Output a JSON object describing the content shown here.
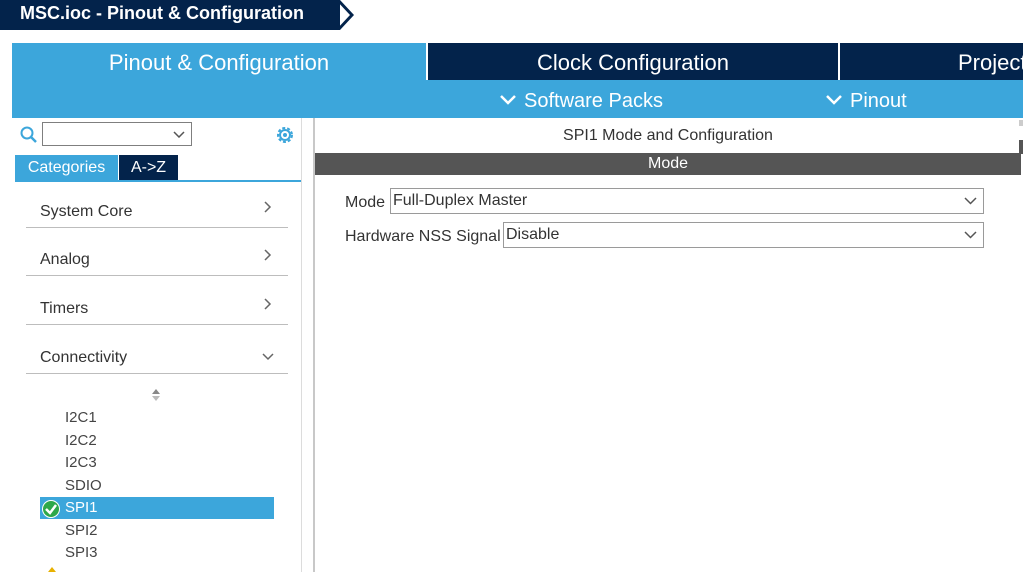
{
  "window": {
    "title": "MSC.ioc - Pinout & Configuration"
  },
  "tabs": [
    {
      "label": "Pinout & Configuration",
      "active": true
    },
    {
      "label": "Clock Configuration",
      "active": false
    },
    {
      "label": "Project Manager",
      "active": false
    }
  ],
  "subbar": {
    "software_packs": "Software Packs",
    "pinout": "Pinout"
  },
  "left": {
    "search_value": "",
    "category_tabs": [
      "Categories",
      "A->Z"
    ],
    "categories": [
      {
        "label": "System Core",
        "expanded": false
      },
      {
        "label": "Analog",
        "expanded": false
      },
      {
        "label": "Timers",
        "expanded": false
      },
      {
        "label": "Connectivity",
        "expanded": true
      }
    ],
    "connectivity_items": [
      "I2C1",
      "I2C2",
      "I2C3",
      "SDIO",
      "SPI1",
      "SPI2",
      "SPI3"
    ],
    "selected_item": "SPI1"
  },
  "right": {
    "title": "SPI1 Mode and Configuration",
    "mode_header": "Mode",
    "mode_label": "Mode",
    "mode_value": "Full-Duplex Master",
    "nss_label": "Hardware NSS Signal",
    "nss_value": "Disable"
  },
  "colors": {
    "navy": "#03234b",
    "accent": "#3ca6db",
    "header_gray": "#555555"
  }
}
